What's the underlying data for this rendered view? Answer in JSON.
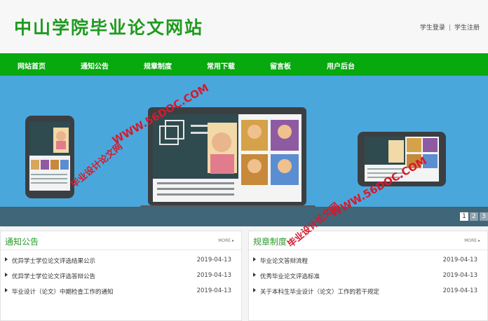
{
  "header": {
    "site_title": "中山学院毕业论文网站",
    "login": "学生登录",
    "separator": "|",
    "register": "学生注册"
  },
  "nav": {
    "items": [
      {
        "label": "网站首页"
      },
      {
        "label": "通知公告"
      },
      {
        "label": "规章制度"
      },
      {
        "label": "常用下载"
      },
      {
        "label": "留言板"
      },
      {
        "label": "用户后台"
      }
    ]
  },
  "banner": {
    "pages": [
      "1",
      "2",
      "3"
    ],
    "active_page": "1"
  },
  "notices": {
    "title": "通知公告",
    "more": "MORE ▸",
    "items": [
      {
        "title": "优异学士学位论文评选结果公示",
        "date": "2019-04-13"
      },
      {
        "title": "优异学士学位论文评选答辩公告",
        "date": "2019-04-13"
      },
      {
        "title": "毕业设计（论文）中期检查工作的通知",
        "date": "2019-04-13"
      }
    ]
  },
  "rules": {
    "title": "规章制度",
    "more": "MORE ▸",
    "items": [
      {
        "title": "毕业论文答辩流程",
        "date": "2019-04-13"
      },
      {
        "title": "优秀毕业论文评选标准",
        "date": "2019-04-13"
      },
      {
        "title": "关于本科生毕业设计（论文）工作的若干规定",
        "date": "2019-04-13"
      }
    ]
  },
  "watermark": {
    "url": "WWW.56DOC.COM",
    "site": "毕业设计论文网"
  },
  "colors": {
    "brand_green": "#08a80f",
    "title_green": "#1f9a1f",
    "banner_blue": "#4aa7dc"
  }
}
